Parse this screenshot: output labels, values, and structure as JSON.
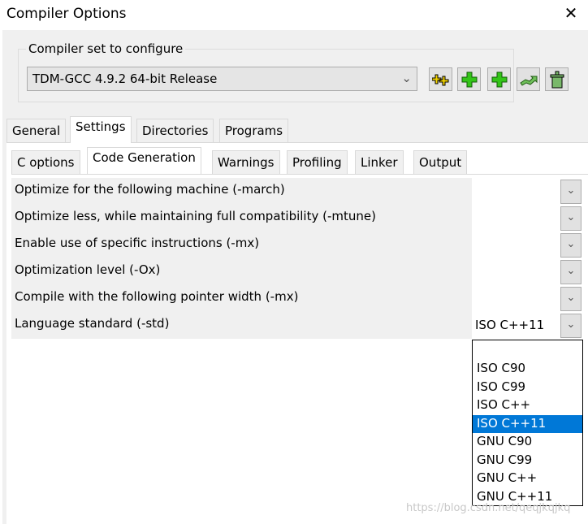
{
  "window": {
    "title": "Compiler Options",
    "close_icon": "close-icon"
  },
  "compiler_set": {
    "label": "Compiler set to configure",
    "selected": "TDM-GCC 4.9.2 64-bit Release",
    "buttons": [
      {
        "name": "add-default-sets-button",
        "icon": "double-plus-yellow-icon"
      },
      {
        "name": "add-empty-set-button",
        "icon": "plus-green-icon"
      },
      {
        "name": "add-folder-set-button",
        "icon": "plus-green-icon"
      },
      {
        "name": "rename-set-button",
        "icon": "arrow-green-icon"
      },
      {
        "name": "delete-set-button",
        "icon": "trash-icon"
      }
    ]
  },
  "tabs": [
    {
      "label": "General"
    },
    {
      "label": "Settings",
      "selected": true
    },
    {
      "label": "Directories"
    },
    {
      "label": "Programs"
    }
  ],
  "subtabs": [
    {
      "label": "C options"
    },
    {
      "label": "Code Generation",
      "selected": true
    },
    {
      "label": "Warnings"
    },
    {
      "label": "Profiling"
    },
    {
      "label": "Linker"
    },
    {
      "label": "Output"
    }
  ],
  "options": [
    {
      "label": "Optimize for the following machine (-march)",
      "value": ""
    },
    {
      "label": "Optimize less, while maintaining full compatibility (-mtune)",
      "value": ""
    },
    {
      "label": "Enable use of specific instructions (-mx)",
      "value": ""
    },
    {
      "label": "Optimization level (-Ox)",
      "value": ""
    },
    {
      "label": "Compile with the following pointer width (-mx)",
      "value": ""
    },
    {
      "label": "Language standard (-std)",
      "value": "ISO C++11"
    }
  ],
  "dropdown": {
    "options": [
      "ISO C90",
      "ISO C99",
      "ISO C++",
      "ISO C++11",
      "GNU C90",
      "GNU C99",
      "GNU C++",
      "GNU C++11"
    ],
    "selected": "ISO C++11",
    "highlight_color": "#0078d7"
  },
  "watermark": "https://blog.csdn.net/qeqjkqjkq"
}
